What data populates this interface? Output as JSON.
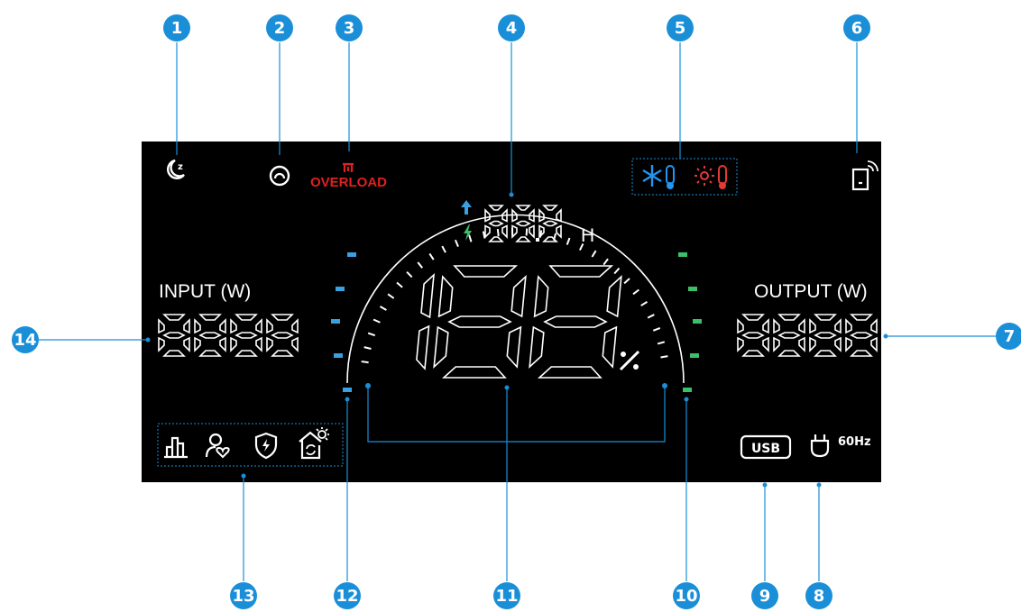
{
  "callouts": [
    {
      "n": "1"
    },
    {
      "n": "2"
    },
    {
      "n": "3"
    },
    {
      "n": "4"
    },
    {
      "n": "5"
    },
    {
      "n": "6"
    },
    {
      "n": "7"
    },
    {
      "n": "8"
    },
    {
      "n": "9"
    },
    {
      "n": "10"
    },
    {
      "n": "11"
    },
    {
      "n": "12"
    },
    {
      "n": "13"
    },
    {
      "n": "14"
    }
  ],
  "display": {
    "overload_label": "OVERLOAD",
    "input_label": "INPUT (W)",
    "output_label": "OUTPUT (W)",
    "input_value": "8888",
    "output_value": "8888",
    "battery_value": "188",
    "percent_symbol": "%",
    "time_value": "88.8",
    "time_unit": "H",
    "usb_label": "USB",
    "ac_freq_label": "60Hz"
  },
  "colors": {
    "background": "#000000",
    "callout": "#1a8fd8",
    "overload": "#e02020",
    "charge_bar": "#3aa0e0",
    "discharge_bar": "#3cbf6a",
    "cold": "#2196f3",
    "hot": "#e53935"
  },
  "icons": [
    "sleep-moon-icon",
    "power-mode-icon",
    "overload-icon",
    "charging-arrow-icon",
    "lightning-icon",
    "cold-temp-icon",
    "hot-temp-icon",
    "wireless-device-icon",
    "usb-icon",
    "ac-plug-icon",
    "chart-icon",
    "user-heart-icon",
    "shield-bolt-icon",
    "home-solar-icon"
  ]
}
